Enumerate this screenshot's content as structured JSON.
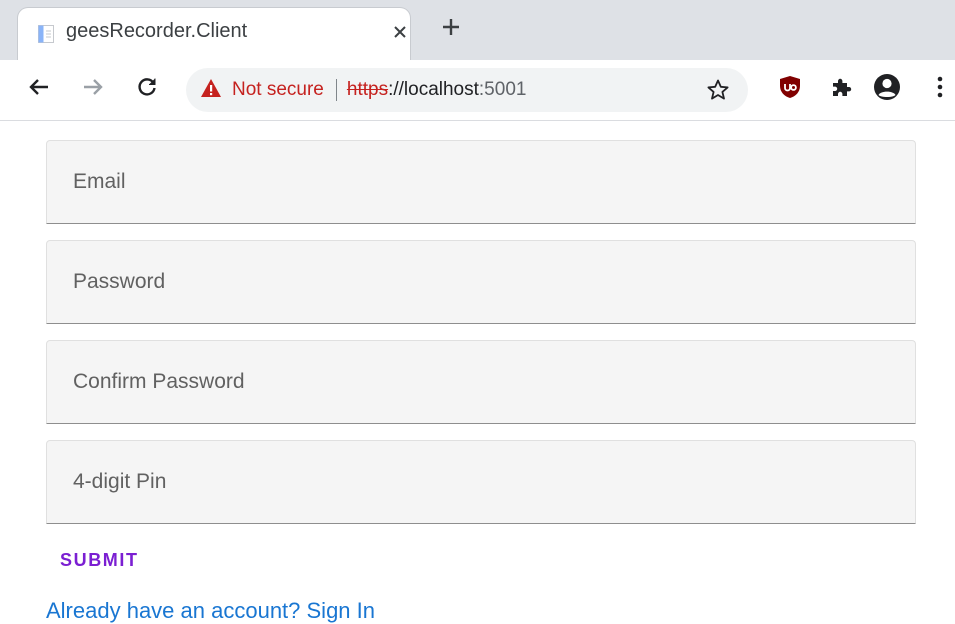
{
  "browser": {
    "tab": {
      "title": "geesRecorder.Client",
      "close_icon": "close-icon",
      "favicon": "page-icon"
    },
    "new_tab_icon": "plus-icon",
    "toolbar": {
      "back_icon": "arrow-left-icon",
      "forward_icon": "arrow-right-icon",
      "reload_icon": "reload-icon",
      "security_icon": "warning-triangle-icon",
      "security_label": "Not secure",
      "url_scheme": "https",
      "url_rest_host": "://localhost",
      "url_port": ":5001",
      "bookmark_icon": "star-icon",
      "extensions": [
        "ublock-shield-icon",
        "puzzle-icon",
        "account-icon",
        "more-vertical-icon"
      ]
    },
    "colors": {
      "not_secure": "#c5221f",
      "tabstrip": "#dee1e6",
      "omnibox": "#f1f3f4"
    }
  },
  "form": {
    "email": {
      "placeholder": "Email",
      "value": ""
    },
    "password": {
      "placeholder": "Password",
      "value": ""
    },
    "confirm_password": {
      "placeholder": "Confirm Password",
      "value": ""
    },
    "pin": {
      "placeholder": "4-digit Pin",
      "value": ""
    },
    "submit_label": "SUBMIT",
    "signin_link": "Already have an account? Sign In"
  },
  "colors": {
    "submit": "#7b1fd2",
    "link": "#1976d2",
    "field_background": "#f5f5f5"
  }
}
